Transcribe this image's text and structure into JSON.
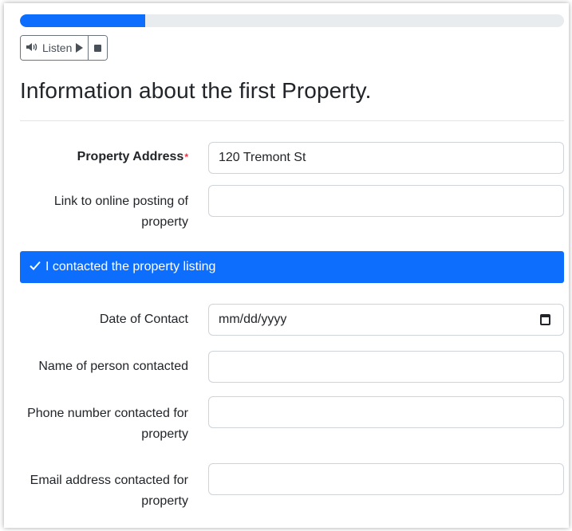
{
  "progress": {
    "value_percent": 23,
    "color": "#0d6efd"
  },
  "audio": {
    "listen_label": "Listen"
  },
  "page": {
    "title": "Information about the first Property."
  },
  "fields": {
    "property_address": {
      "label": "Property Address",
      "required_mark": "*",
      "value": "120 Tremont St"
    },
    "online_link": {
      "label": "Link to online posting of property",
      "value": ""
    },
    "contacted": {
      "label": "I contacted the property listing",
      "checked": true
    },
    "date_of_contact": {
      "label": "Date of Contact",
      "placeholder": "mm/dd/yyyy"
    },
    "person_name": {
      "label": "Name of person contacted",
      "value": ""
    },
    "phone": {
      "label": "Phone number contacted for property",
      "value": ""
    },
    "email": {
      "label": "Email address contacted for property",
      "value": ""
    }
  }
}
